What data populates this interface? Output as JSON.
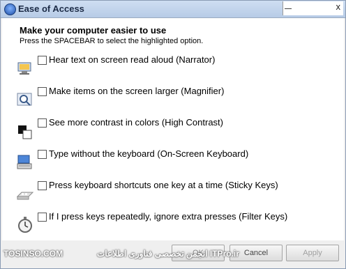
{
  "window": {
    "title": "Ease of Access"
  },
  "header": {
    "heading": "Make your computer easier to use",
    "instruction": "Press the SPACEBAR to select the highlighted option."
  },
  "options": [
    {
      "label": "Hear text on screen read aloud (Narrator)",
      "checked": false,
      "icon": "narrator-icon"
    },
    {
      "label": "Make items on the screen larger (Magnifier)",
      "checked": false,
      "icon": "magnifier-icon"
    },
    {
      "label": "See more contrast in colors (High Contrast)",
      "checked": false,
      "icon": "high-contrast-icon"
    },
    {
      "label": "Type without the keyboard (On-Screen Keyboard)",
      "checked": false,
      "icon": "keyboard-icon"
    },
    {
      "label": "Press keyboard shortcuts one key at a time (Sticky Keys)",
      "checked": false,
      "icon": "sticky-keys-icon"
    },
    {
      "label": "If I press keys repeatedly, ignore extra presses (Filter Keys)",
      "checked": false,
      "icon": "stopwatch-icon"
    }
  ],
  "buttons": {
    "ok": "OK",
    "cancel": "Cancel",
    "apply": "Apply"
  },
  "watermark": {
    "left": "TOSINSO.COM",
    "right": "انجمن تخصصی فناوری اطلاعات ITPro.ir"
  }
}
